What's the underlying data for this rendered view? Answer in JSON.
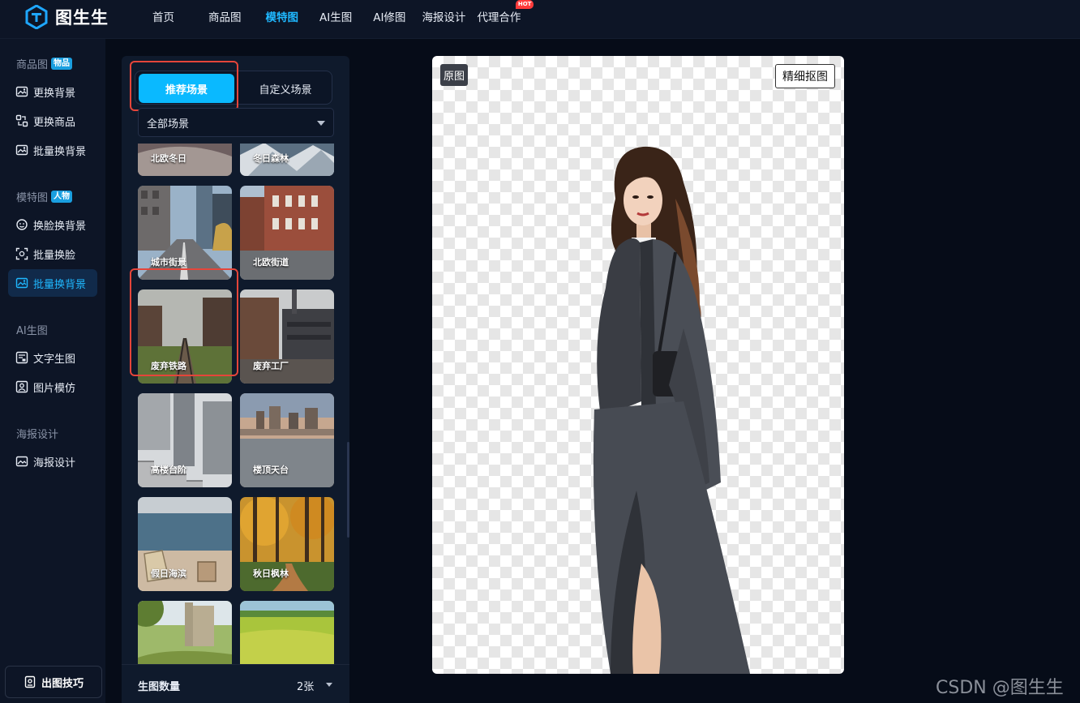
{
  "app": {
    "name": "图生生"
  },
  "nav": {
    "items": [
      {
        "label": "首页",
        "active": false
      },
      {
        "label": "商品图",
        "active": false
      },
      {
        "label": "模特图",
        "active": true
      },
      {
        "label": "AI生图",
        "active": false
      },
      {
        "label": "AI修图",
        "active": false
      },
      {
        "label": "海报设计",
        "active": false
      },
      {
        "label": "代理合作",
        "active": false
      }
    ],
    "hot_badge": "HOT"
  },
  "sidebar": {
    "groups": [
      {
        "title": "商品图",
        "badge": "物品",
        "items": [
          {
            "label": "更换背景",
            "icon": "image-swap-icon"
          },
          {
            "label": "更换商品",
            "icon": "product-swap-icon"
          },
          {
            "label": "批量换背景",
            "icon": "batch-background-icon"
          }
        ]
      },
      {
        "title": "模特图",
        "badge": "人物",
        "items": [
          {
            "label": "换脸换背景",
            "icon": "face-swap-icon"
          },
          {
            "label": "批量换脸",
            "icon": "batch-face-icon"
          },
          {
            "label": "批量换背景",
            "icon": "batch-background-icon",
            "active": true
          }
        ]
      },
      {
        "title": "AI生图",
        "badge": "",
        "items": [
          {
            "label": "文字生图",
            "icon": "text-to-image-icon"
          },
          {
            "label": "图片模仿",
            "icon": "image-imitate-icon"
          }
        ]
      },
      {
        "title": "海报设计",
        "badge": "",
        "items": [
          {
            "label": "海报设计",
            "icon": "poster-icon"
          }
        ]
      }
    ],
    "tips_button": "出图技巧"
  },
  "scene_panel": {
    "tabs": [
      {
        "label": "推荐场景",
        "active": true
      },
      {
        "label": "自定义场景",
        "active": false
      }
    ],
    "filter_value": "全部场景",
    "scenes": [
      {
        "label": "北欧冬日"
      },
      {
        "label": "冬日森林"
      },
      {
        "label": "城市街景",
        "selected": true
      },
      {
        "label": "北欧街道"
      },
      {
        "label": "废弃铁路"
      },
      {
        "label": "废弃工厂"
      },
      {
        "label": "高楼台阶"
      },
      {
        "label": "楼顶天台"
      },
      {
        "label": "假日海滨"
      },
      {
        "label": "秋日枫林"
      },
      {
        "label": ""
      },
      {
        "label": ""
      }
    ],
    "count_label": "生图数量",
    "count_value": "2张"
  },
  "preview": {
    "original_tag": "原图",
    "refine_button": "精细抠图"
  },
  "watermark": "CSDN @图生生"
}
